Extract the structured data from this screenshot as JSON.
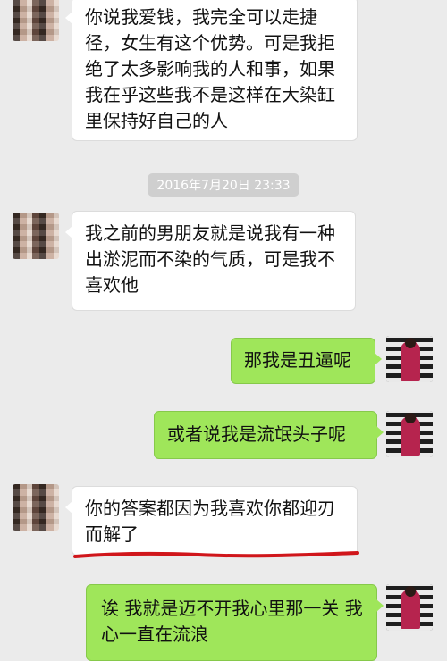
{
  "timestamp": "2016年7月20日 23:33",
  "messages": [
    {
      "side": "incoming",
      "text": "你说我爱钱，我完全可以走捷径，女生有这个优势。可是我拒绝了太多影响我的人和事，如果我在乎这些我不是这样在大染缸里保持好自己的人"
    },
    {
      "side": "incoming",
      "text": "我之前的男朋友就是说我有一种出淤泥而不染的气质，可是我不喜欢他"
    },
    {
      "side": "outgoing",
      "text": "那我是丑逼呢"
    },
    {
      "side": "outgoing",
      "text": "或者说我是流氓头子呢"
    },
    {
      "side": "incoming",
      "text": "你的答案都因为我喜欢你都迎刃而解了"
    },
    {
      "side": "outgoing",
      "text": "诶 我就是迈不开我心里那一关 我心一直在流浪"
    }
  ],
  "colors": {
    "background": "#ebebeb",
    "incoming_bubble": "#ffffff",
    "outgoing_bubble": "#9fe65a",
    "annotation": "#d0161b"
  },
  "icons": {
    "her_avatar": "avatar-icon",
    "my_avatar": "avatar-icon"
  }
}
